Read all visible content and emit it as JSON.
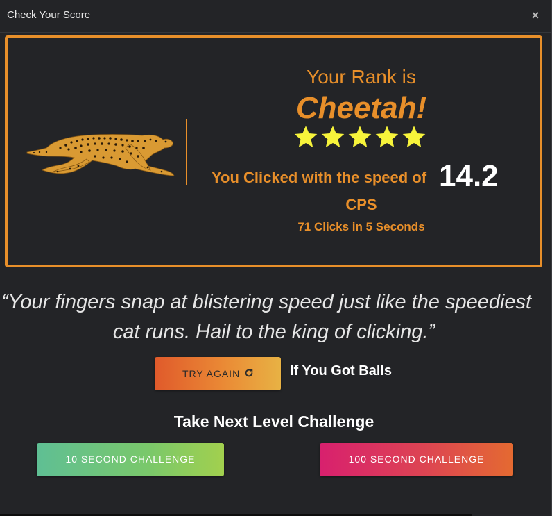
{
  "modal": {
    "title": "Check Your Score",
    "close_icon": "×"
  },
  "result": {
    "rank_label": "Your Rank is",
    "rank_name": "Cheetah!",
    "stars": 5,
    "speed_prefix": "You Clicked with the speed of",
    "speed_value": "14.2",
    "speed_unit": "CPS",
    "clicks_summary": "71 Clicks in 5 Seconds"
  },
  "quote": {
    "line1": "“Your fingers snap at blistering speed just like the speediest",
    "line2": "cat runs. Hail to the king of clicking.”"
  },
  "actions": {
    "try_again_label": "TRY AGAIN",
    "try_again_icon": "refresh-icon",
    "dare_text": "If You Got Balls"
  },
  "next_level": {
    "heading": "Take Next Level Challenge",
    "challenge_10_label": "10 SECOND CHALLENGE",
    "challenge_100_label": "100 SECOND CHALLENGE"
  },
  "colors": {
    "background": "#232427",
    "accent_orange": "#e88f2a",
    "star_yellow": "#f7f43b"
  }
}
